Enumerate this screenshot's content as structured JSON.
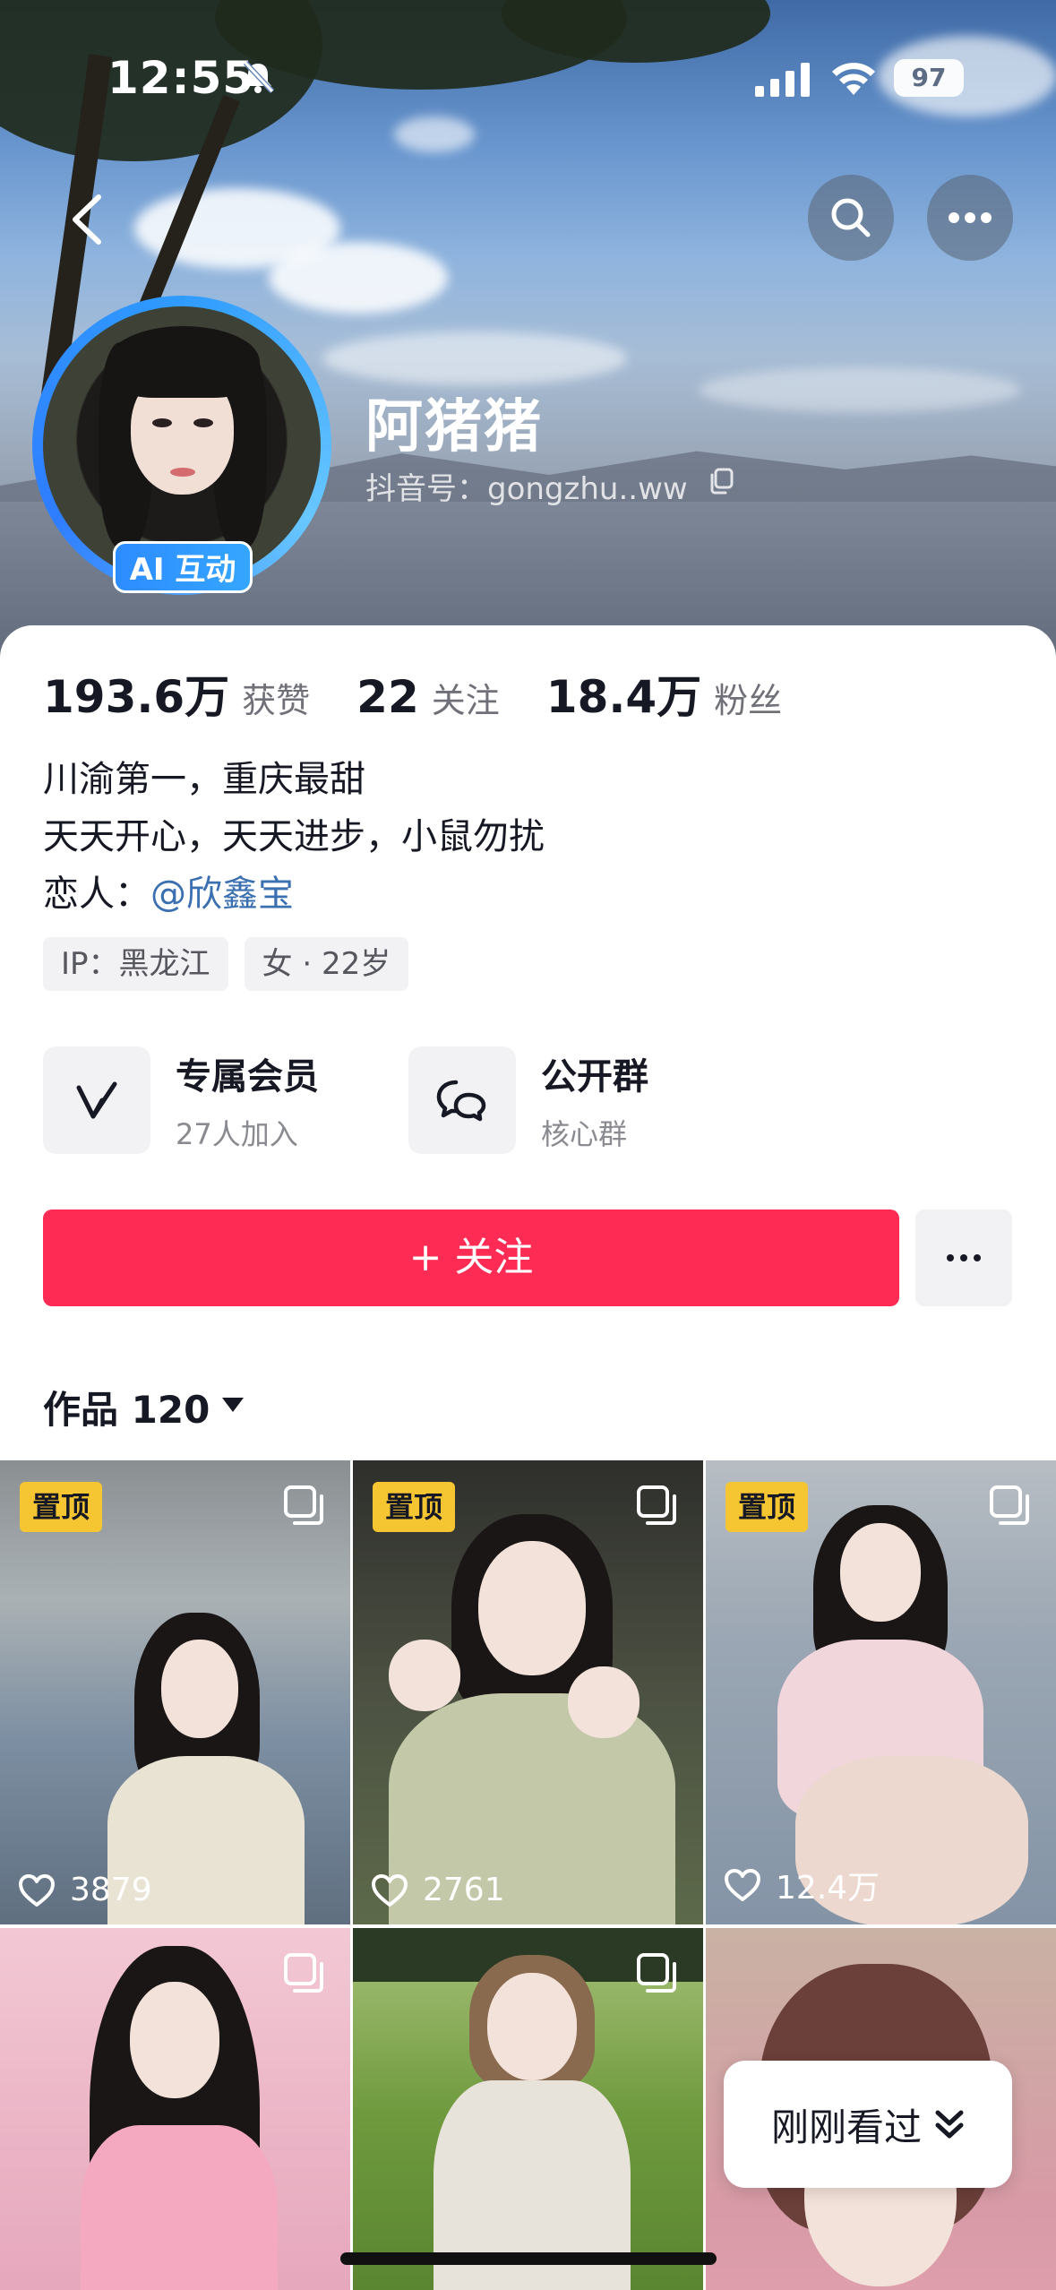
{
  "status_bar": {
    "time": "12:55",
    "battery": "97"
  },
  "profile": {
    "nickname": "阿猪猪",
    "douyin_id": "抖音号：gongzhu..ww",
    "ai_badge": "AI 互动"
  },
  "stats": {
    "likes_value": "193.6万",
    "likes_label": "获赞",
    "following_value": "22",
    "following_label": "关注",
    "followers_value": "18.4万",
    "followers_label": "粉丝"
  },
  "bio": {
    "line1": "川渝第一，重庆最甜",
    "line2": "天天开心，天天进步，小鼠勿扰",
    "line3_prefix": "恋人：",
    "line3_mention": "@欣鑫宝"
  },
  "tags": {
    "ip": "IP：黑龙江",
    "gender_age": "女 · 22岁"
  },
  "features": {
    "membership_title": "专属会员",
    "membership_sub": "27人加入",
    "group_title": "公开群",
    "group_sub": "核心群"
  },
  "actions": {
    "follow_label": "+ 关注"
  },
  "works": {
    "tab_label": "作品 120"
  },
  "videos": [
    {
      "pinned_label": "置顶",
      "likes": "3879"
    },
    {
      "pinned_label": "置顶",
      "likes": "2761"
    },
    {
      "pinned_label": "置顶",
      "likes": "12.4万"
    },
    {
      "pinned_label": "",
      "likes": ""
    },
    {
      "pinned_label": "",
      "likes": ""
    },
    {
      "pinned_label": "",
      "likes": ""
    }
  ],
  "recent": {
    "label": "刚刚看过"
  },
  "colors": {
    "accent": "#fe2c55",
    "pin": "#f6c532",
    "mention": "#3a6fb0",
    "ai_badge": "#2d8cff"
  },
  "icons": [
    "back-icon",
    "search-icon",
    "more-icon",
    "copy-icon",
    "membership-icon",
    "group-chat-icon",
    "caret-down-icon",
    "multi-image-icon",
    "heart-icon",
    "double-chevron-down-icon"
  ]
}
